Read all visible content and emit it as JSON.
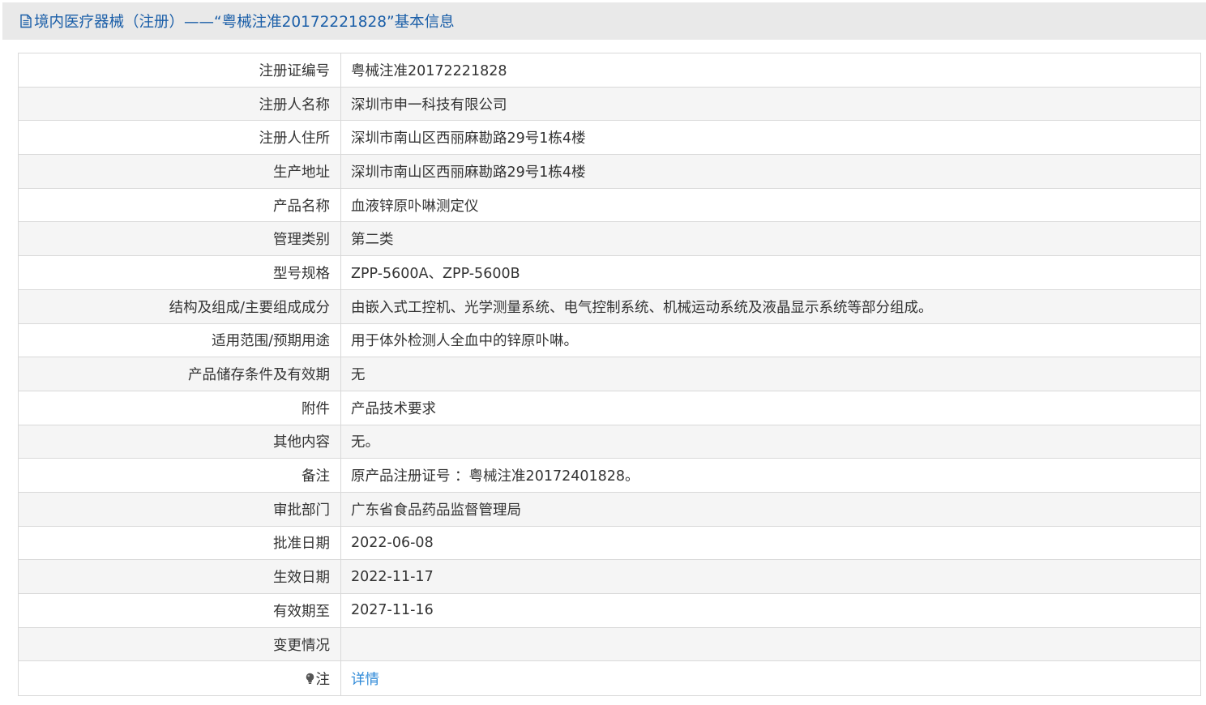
{
  "header": {
    "title": "境内医疗器械（注册）——“粤械注准20172221828”基本信息",
    "icon": "document-icon"
  },
  "rows": [
    {
      "label": "注册证编号",
      "value": "粤械注准20172221828"
    },
    {
      "label": "注册人名称",
      "value": "深圳市申一科技有限公司"
    },
    {
      "label": "注册人住所",
      "value": "深圳市南山区西丽麻勘路29号1栋4楼"
    },
    {
      "label": "生产地址",
      "value": "深圳市南山区西丽麻勘路29号1栋4楼"
    },
    {
      "label": "产品名称",
      "value": "血液锌原卟啉测定仪"
    },
    {
      "label": "管理类别",
      "value": "第二类"
    },
    {
      "label": "型号规格",
      "value": "ZPP-5600A、ZPP-5600B"
    },
    {
      "label": "结构及组成/主要组成成分",
      "value": "由嵌入式工控机、光学测量系统、电气控制系统、机械运动系统及液晶显示系统等部分组成。"
    },
    {
      "label": "适用范围/预期用途",
      "value": "用于体外检测人全血中的锌原卟啉。"
    },
    {
      "label": "产品储存条件及有效期",
      "value": "无"
    },
    {
      "label": "附件",
      "value": "产品技术要求"
    },
    {
      "label": "其他内容",
      "value": "无。"
    },
    {
      "label": "备注",
      "value": "原产品注册证号 ：粤械注准20172401828。"
    },
    {
      "label": "审批部门",
      "value": "广东省食品药品监督管理局"
    },
    {
      "label": "批准日期",
      "value": "2022-06-08"
    },
    {
      "label": "生效日期",
      "value": "2022-11-17"
    },
    {
      "label": "有效期至",
      "value": "2027-11-16"
    },
    {
      "label": "变更情况",
      "value": ""
    }
  ],
  "note": {
    "label": "注",
    "icon": "lightbulb-icon",
    "link_text": "详情"
  },
  "colors": {
    "header_bg": "#e9e9e9",
    "header_text": "#1a5ea8",
    "link": "#2f8ad8",
    "border": "#d9d9d9",
    "stripe": "#f5f5f5"
  }
}
